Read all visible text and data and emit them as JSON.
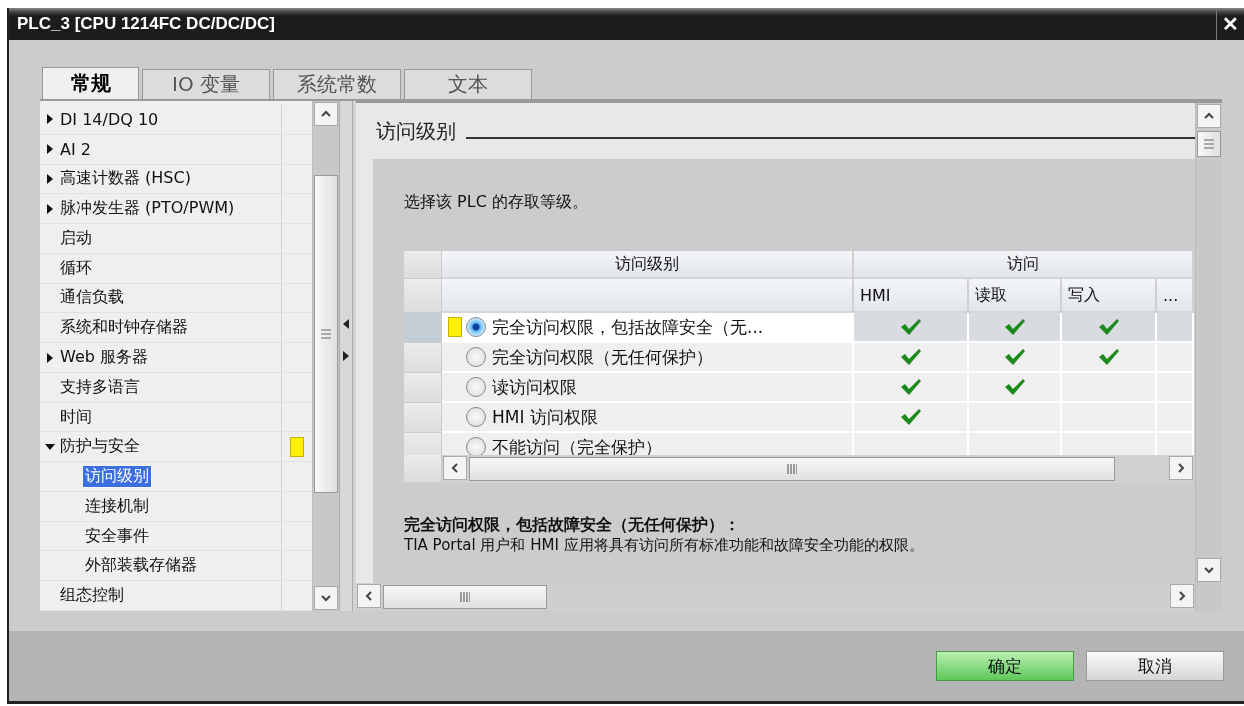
{
  "window": {
    "title": "PLC_3 [CPU 1214FC DC/DC/DC]",
    "close": "✕"
  },
  "tabs": [
    {
      "label": "常规",
      "selected": true
    },
    {
      "label": "IO 变量",
      "selected": false
    },
    {
      "label": "系统常数",
      "selected": false
    },
    {
      "label": "文本",
      "selected": false
    }
  ],
  "tree": [
    {
      "label": "DI 14/DQ 10",
      "expanded": false,
      "selected": false,
      "flagged": false
    },
    {
      "label": "AI 2",
      "expanded": false,
      "selected": false,
      "flagged": false
    },
    {
      "label": "高速计数器 (HSC)",
      "expanded": false,
      "selected": false,
      "flagged": false
    },
    {
      "label": "脉冲发生器 (PTO/PWM)",
      "expanded": false,
      "selected": false,
      "flagged": false
    },
    {
      "label": "启动",
      "selected": false,
      "flagged": false
    },
    {
      "label": "循环",
      "selected": false,
      "flagged": false
    },
    {
      "label": "通信负载",
      "selected": false,
      "flagged": false
    },
    {
      "label": "系统和时钟存储器",
      "selected": false,
      "flagged": false
    },
    {
      "label": "Web 服务器",
      "expanded": false,
      "selected": false,
      "flagged": false
    },
    {
      "label": "支持多语言",
      "selected": false,
      "flagged": false
    },
    {
      "label": "时间",
      "selected": false,
      "flagged": false
    },
    {
      "label": "防护与安全",
      "expanded": true,
      "selected": false,
      "flagged": true,
      "children": [
        {
          "label": "访问级别",
          "selected": true,
          "flagged": false
        },
        {
          "label": "连接机制",
          "selected": false,
          "flagged": false
        },
        {
          "label": "安全事件",
          "selected": false,
          "flagged": false
        },
        {
          "label": "外部装载存储器",
          "selected": false,
          "flagged": false
        }
      ]
    },
    {
      "label": "组态控制",
      "selected": false,
      "flagged": false
    }
  ],
  "section": {
    "title": "访问级别",
    "intro": "选择该 PLC 的存取等级。"
  },
  "table": {
    "group_headers": [
      "访问级别",
      "访问"
    ],
    "columns": [
      "HMI",
      "读取",
      "写入",
      "..."
    ],
    "rows": [
      {
        "label": "完全访问权限，包括故障安全（无...",
        "selected": true,
        "flagged": true,
        "hmi": true,
        "read": true,
        "write": true
      },
      {
        "label": "完全访问权限（无任何保护）",
        "selected": false,
        "flagged": false,
        "hmi": true,
        "read": true,
        "write": true
      },
      {
        "label": "读访问权限",
        "selected": false,
        "flagged": false,
        "hmi": true,
        "read": true,
        "write": false
      },
      {
        "label": "HMI 访问权限",
        "selected": false,
        "flagged": false,
        "hmi": true,
        "read": false,
        "write": false
      },
      {
        "label": "不能访问（完全保护）",
        "selected": false,
        "flagged": false,
        "hmi": false,
        "read": false,
        "write": false
      }
    ]
  },
  "description": {
    "title": "完全访问权限，包括故障安全（无任何保护）：",
    "text": "TIA Portal 用户和 HMI 应用将具有访问所有标准功能和故障安全功能的权限。"
  },
  "buttons": [
    {
      "label": "确定",
      "kind": "primary"
    },
    {
      "label": "取消",
      "kind": "default"
    }
  ]
}
